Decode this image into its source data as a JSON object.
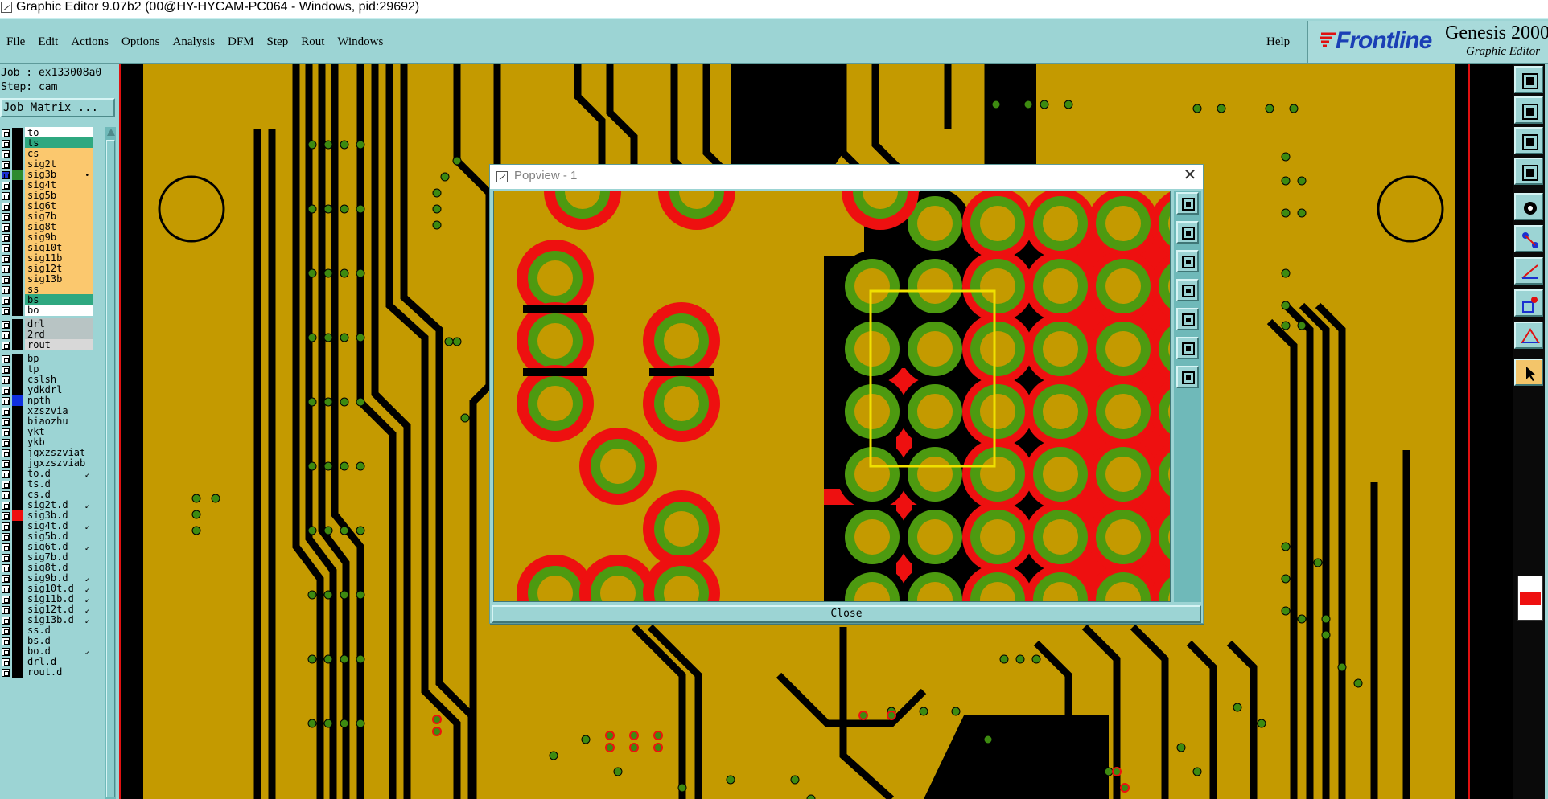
{
  "window": {
    "title": "Graphic Editor 9.07b2 (00@HY-HYCAM-PC064 - Windows, pid:29692)"
  },
  "menubar": {
    "items": [
      "File",
      "Edit",
      "Actions",
      "Options",
      "Analysis",
      "DFM",
      "Step",
      "Rout",
      "Windows"
    ],
    "help": "Help",
    "logo": "Frontline",
    "product": "Genesis 2000",
    "subtitle": "Graphic Editor"
  },
  "left_panel": {
    "job": "Job : ex133008a0",
    "step": "Step: cam",
    "job_matrix_button": "Job Matrix ..."
  },
  "layers": [
    {
      "name": "to",
      "bg": "#ffffff",
      "swatch": "#000000",
      "mark": ""
    },
    {
      "name": "ts",
      "bg": "#2fa880",
      "swatch": "#000000",
      "mark": ""
    },
    {
      "name": "cs",
      "bg": "#fbc86e",
      "swatch": "#000000",
      "mark": ""
    },
    {
      "name": "sig2t",
      "bg": "#fbc86e",
      "swatch": "#000000",
      "mark": ""
    },
    {
      "name": "sig3b",
      "bg": "#fbc86e",
      "swatch": "#2e8b2e",
      "mark": "•",
      "active": true
    },
    {
      "name": "sig4t",
      "bg": "#fbc86e",
      "swatch": "#000000",
      "mark": ""
    },
    {
      "name": "sig5b",
      "bg": "#fbc86e",
      "swatch": "#000000",
      "mark": ""
    },
    {
      "name": "sig6t",
      "bg": "#fbc86e",
      "swatch": "#000000",
      "mark": ""
    },
    {
      "name": "sig7b",
      "bg": "#fbc86e",
      "swatch": "#000000",
      "mark": ""
    },
    {
      "name": "sig8t",
      "bg": "#fbc86e",
      "swatch": "#000000",
      "mark": ""
    },
    {
      "name": "sig9b",
      "bg": "#fbc86e",
      "swatch": "#000000",
      "mark": ""
    },
    {
      "name": "sig10t",
      "bg": "#fbc86e",
      "swatch": "#000000",
      "mark": ""
    },
    {
      "name": "sig11b",
      "bg": "#fbc86e",
      "swatch": "#000000",
      "mark": ""
    },
    {
      "name": "sig12t",
      "bg": "#fbc86e",
      "swatch": "#000000",
      "mark": ""
    },
    {
      "name": "sig13b",
      "bg": "#fbc86e",
      "swatch": "#000000",
      "mark": ""
    },
    {
      "name": "ss",
      "bg": "#fbc86e",
      "swatch": "#000000",
      "mark": ""
    },
    {
      "name": "bs",
      "bg": "#2fa880",
      "swatch": "#000000",
      "mark": ""
    },
    {
      "name": "bo",
      "bg": "#ffffff",
      "swatch": "#000000",
      "mark": ""
    },
    {
      "name": "drl",
      "bg": "#b8c4c4",
      "swatch": "#000000",
      "mark": "",
      "gap": true
    },
    {
      "name": "2rd",
      "bg": "#b8c4c4",
      "swatch": "#000000",
      "mark": ""
    },
    {
      "name": "rout",
      "bg": "#d8d8d8",
      "swatch": "#000000",
      "mark": ""
    },
    {
      "name": "bp",
      "bg": "#9cd4d4",
      "swatch": "#000000",
      "mark": "",
      "gap": true
    },
    {
      "name": "tp",
      "bg": "#9cd4d4",
      "swatch": "#000000",
      "mark": ""
    },
    {
      "name": "cslsh",
      "bg": "#9cd4d4",
      "swatch": "#000000",
      "mark": ""
    },
    {
      "name": "ydkdrl",
      "bg": "#9cd4d4",
      "swatch": "#000000",
      "mark": ""
    },
    {
      "name": "npth",
      "bg": "#9cd4d4",
      "swatch": "#1030e0",
      "mark": ""
    },
    {
      "name": "xzszvia",
      "bg": "#9cd4d4",
      "swatch": "#000000",
      "mark": ""
    },
    {
      "name": "biaozhu",
      "bg": "#9cd4d4",
      "swatch": "#000000",
      "mark": ""
    },
    {
      "name": "ykt",
      "bg": "#9cd4d4",
      "swatch": "#000000",
      "mark": ""
    },
    {
      "name": "ykb",
      "bg": "#9cd4d4",
      "swatch": "#000000",
      "mark": ""
    },
    {
      "name": "jgxzszviat",
      "bg": "#9cd4d4",
      "swatch": "#000000",
      "mark": ""
    },
    {
      "name": "jgxzszviab",
      "bg": "#9cd4d4",
      "swatch": "#000000",
      "mark": ""
    },
    {
      "name": "to.d",
      "bg": "#9cd4d4",
      "swatch": "#000000",
      "mark": "↙"
    },
    {
      "name": "ts.d",
      "bg": "#9cd4d4",
      "swatch": "#000000",
      "mark": ""
    },
    {
      "name": "cs.d",
      "bg": "#9cd4d4",
      "swatch": "#000000",
      "mark": ""
    },
    {
      "name": "sig2t.d",
      "bg": "#9cd4d4",
      "swatch": "#000000",
      "mark": "↙"
    },
    {
      "name": "sig3b.d",
      "bg": "#9cd4d4",
      "swatch": "#ee1010",
      "mark": ""
    },
    {
      "name": "sig4t.d",
      "bg": "#9cd4d4",
      "swatch": "#000000",
      "mark": "↙"
    },
    {
      "name": "sig5b.d",
      "bg": "#9cd4d4",
      "swatch": "#000000",
      "mark": ""
    },
    {
      "name": "sig6t.d",
      "bg": "#9cd4d4",
      "swatch": "#000000",
      "mark": "↙"
    },
    {
      "name": "sig7b.d",
      "bg": "#9cd4d4",
      "swatch": "#000000",
      "mark": ""
    },
    {
      "name": "sig8t.d",
      "bg": "#9cd4d4",
      "swatch": "#000000",
      "mark": ""
    },
    {
      "name": "sig9b.d",
      "bg": "#9cd4d4",
      "swatch": "#000000",
      "mark": "↙"
    },
    {
      "name": "sig10t.d",
      "bg": "#9cd4d4",
      "swatch": "#000000",
      "mark": "↙"
    },
    {
      "name": "sig11b.d",
      "bg": "#9cd4d4",
      "swatch": "#000000",
      "mark": "↙"
    },
    {
      "name": "sig12t.d",
      "bg": "#9cd4d4",
      "swatch": "#000000",
      "mark": "↙"
    },
    {
      "name": "sig13b.d",
      "bg": "#9cd4d4",
      "swatch": "#000000",
      "mark": "↙"
    },
    {
      "name": "ss.d",
      "bg": "#9cd4d4",
      "swatch": "#000000",
      "mark": ""
    },
    {
      "name": "bs.d",
      "bg": "#9cd4d4",
      "swatch": "#000000",
      "mark": ""
    },
    {
      "name": "bo.d",
      "bg": "#9cd4d4",
      "swatch": "#000000",
      "mark": "↙"
    },
    {
      "name": "drl.d",
      "bg": "#9cd4d4",
      "swatch": "#000000",
      "mark": ""
    },
    {
      "name": "rout.d",
      "bg": "#9cd4d4",
      "swatch": "#000000",
      "mark": ""
    }
  ],
  "popview": {
    "title": "Popview - 1",
    "close_button": "Close",
    "close_x": "✕",
    "tools": [
      "zoom-home-icon",
      "zoom-in-icon",
      "zoom-out-icon",
      "pan-left-icon",
      "pan-right-icon",
      "fit-icon",
      "fit-selection-icon"
    ]
  },
  "right_toolbar": {
    "tools": [
      "clipboard-icon",
      "copy-icon",
      "move-icon",
      "settings-icon",
      "pad-icon",
      "connect-icon",
      "line-icon",
      "feature-icon",
      "triangle-icon",
      "pointer-icon"
    ],
    "active_tool": "pointer-icon"
  },
  "colors": {
    "board": "#c49a00",
    "copper_black": "#000000",
    "via_green": "#4d9a10",
    "pad_red": "#ee1010",
    "panel": "#9cd4d4",
    "highlight_box": "#f0e000"
  }
}
